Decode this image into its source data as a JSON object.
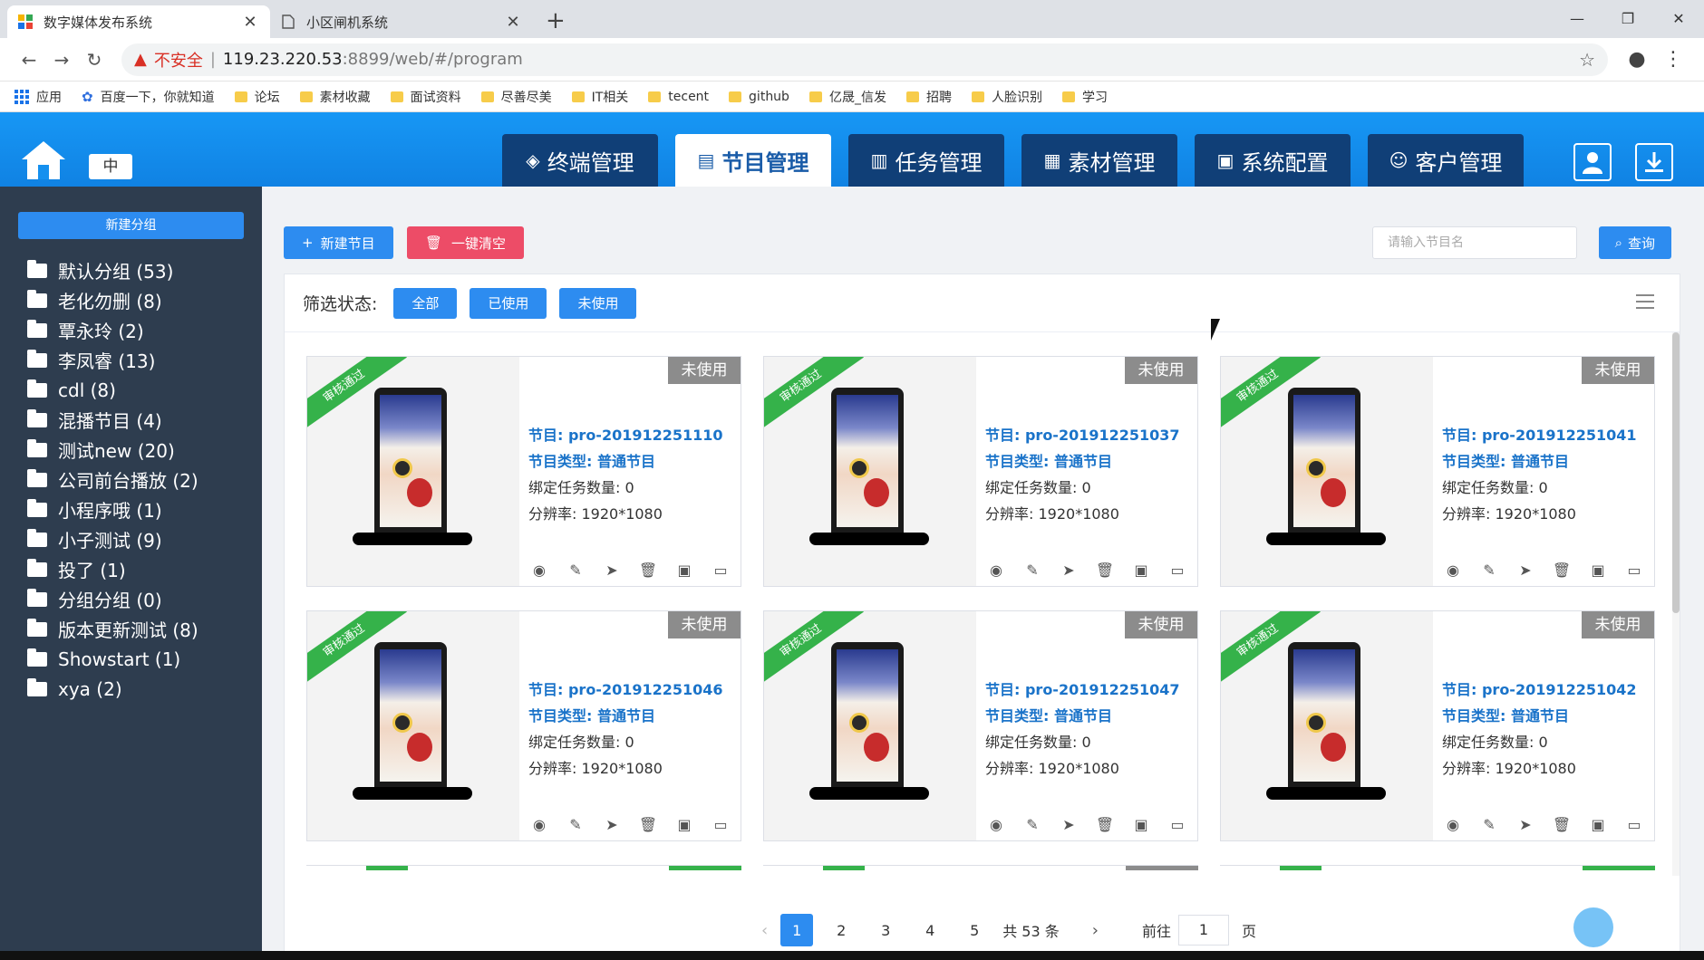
{
  "browser": {
    "tabs": [
      {
        "title": "数字媒体发布系统",
        "active": true
      },
      {
        "title": "小区闸机系统",
        "active": false
      }
    ],
    "url_warning": "不安全",
    "url_host": "119.23.220.53",
    "url_path": ":8899/web/#/program",
    "bookmarks": [
      "应用",
      "百度一下，你就知道",
      "论坛",
      "素材收藏",
      "面试资料",
      "尽善尽美",
      "IT相关",
      "tecent",
      "github",
      "亿晟_信发",
      "招聘",
      "人脸识别",
      "学习"
    ]
  },
  "header": {
    "lang": "中",
    "nav": [
      {
        "label": "终端管理",
        "icon": "layers-icon",
        "active": false
      },
      {
        "label": "节目管理",
        "icon": "program-icon",
        "active": true
      },
      {
        "label": "任务管理",
        "icon": "task-icon",
        "active": false
      },
      {
        "label": "素材管理",
        "icon": "material-icon",
        "active": false
      },
      {
        "label": "系统配置",
        "icon": "config-icon",
        "active": false
      },
      {
        "label": "客户管理",
        "icon": "customer-icon",
        "active": false
      }
    ]
  },
  "sidebar": {
    "new_group": "新建分组",
    "groups": [
      "默认分组 (53)",
      "老化勿删 (8)",
      "覃永玲 (2)",
      "李凤睿 (13)",
      "cdl (8)",
      "混播节目 (4)",
      "测试new (20)",
      "公司前台播放 (2)",
      "小程序哦 (1)",
      "小子测试 (9)",
      "投了 (1)",
      "分组分组 (0)",
      "版本更新测试 (8)",
      "Showstart (1)",
      "xya (2)"
    ]
  },
  "toolbar": {
    "new_program": "新建节目",
    "clear_all": "一键清空",
    "search_placeholder": "请输入节目名",
    "query": "查询",
    "new_color": "#2d8cf0",
    "clear_color": "#ed4c67"
  },
  "filter": {
    "label": "筛选状态:",
    "options": [
      "全部",
      "已使用",
      "未使用"
    ]
  },
  "cards": [
    {
      "ribbon": "审核通过",
      "status": "未使用",
      "name": "节目: pro-201912251110",
      "type": "节目类型: 普通节目",
      "tasks": "绑定任务数量: 0",
      "resolution": "分辨率: 1920*1080"
    },
    {
      "ribbon": "审核通过",
      "status": "未使用",
      "name": "节目: pro-201912251037",
      "type": "节目类型: 普通节目",
      "tasks": "绑定任务数量: 0",
      "resolution": "分辨率: 1920*1080"
    },
    {
      "ribbon": "审核通过",
      "status": "未使用",
      "name": "节目: pro-201912251041",
      "type": "节目类型: 普通节目",
      "tasks": "绑定任务数量: 0",
      "resolution": "分辨率: 1920*1080"
    },
    {
      "ribbon": "审核通过",
      "status": "未使用",
      "name": "节目: pro-201912251046",
      "type": "节目类型: 普通节目",
      "tasks": "绑定任务数量: 0",
      "resolution": "分辨率: 1920*1080"
    },
    {
      "ribbon": "审核通过",
      "status": "未使用",
      "name": "节目: pro-201912251047",
      "type": "节目类型: 普通节目",
      "tasks": "绑定任务数量: 0",
      "resolution": "分辨率: 1920*1080"
    },
    {
      "ribbon": "审核通过",
      "status": "未使用",
      "name": "节目: pro-201912251042",
      "type": "节目类型: 普通节目",
      "tasks": "绑定任务数量: 0",
      "resolution": "分辨率: 1920*1080"
    }
  ],
  "card_actions": [
    "eye-icon",
    "pencil-icon",
    "send-icon",
    "trash-icon",
    "preview-icon",
    "folder-icon"
  ],
  "pagination": {
    "pages": [
      "1",
      "2",
      "3",
      "4",
      "5"
    ],
    "current": "1",
    "total": "共 53 条",
    "goto_label": "前往",
    "goto_value": "1",
    "page_suffix": "页"
  }
}
